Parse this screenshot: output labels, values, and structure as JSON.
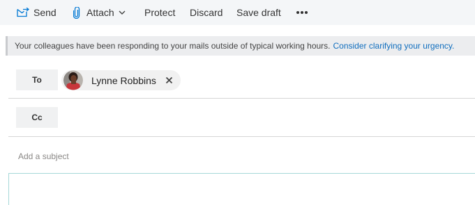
{
  "toolbar": {
    "send_label": "Send",
    "attach_label": "Attach",
    "protect_label": "Protect",
    "discard_label": "Discard",
    "save_draft_label": "Save draft",
    "more_icon": "ellipsis-icon",
    "accent_color": "#0078d4"
  },
  "infobar": {
    "message": "Your colleagues have been responding to your mails outside of typical working hours.",
    "link_text": "Consider clarifying your urgency."
  },
  "recipients": {
    "to_label": "To",
    "cc_label": "Cc",
    "to_chips": [
      {
        "name": "Lynne Robbins",
        "avatar": "person-photo"
      }
    ]
  },
  "subject": {
    "placeholder": "Add a subject",
    "value": ""
  }
}
